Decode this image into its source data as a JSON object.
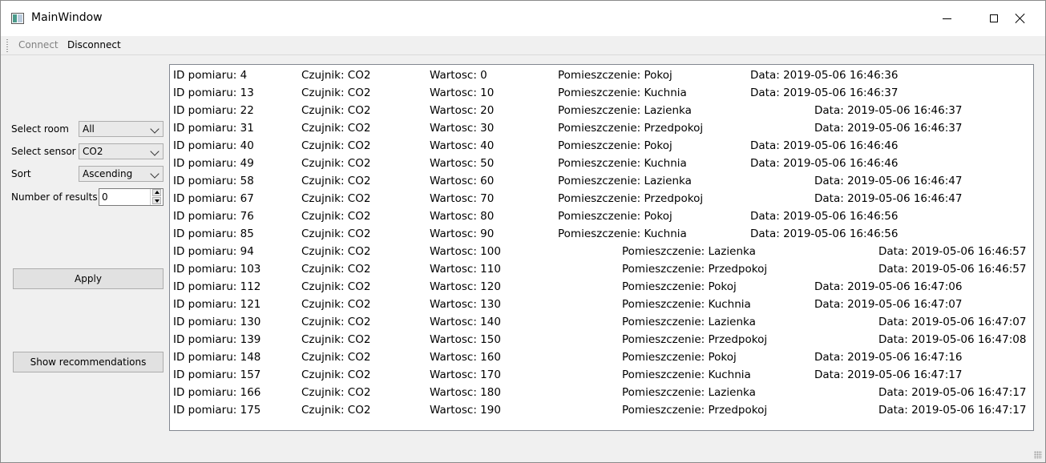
{
  "window": {
    "title": "MainWindow"
  },
  "toolbar": {
    "connect_label": "Connect",
    "disconnect_label": "Disconnect"
  },
  "controls": {
    "room_label": "Select room",
    "room_value": "All",
    "sensor_label": "Select sensor",
    "sensor_value": "CO2",
    "sort_label": "Sort",
    "sort_value": "Ascending",
    "results_label": "Number of results",
    "results_value": "0",
    "apply_label": "Apply",
    "recommend_label": "Show recommendations"
  },
  "results": [
    {
      "id": "ID pomiaru: 4",
      "sensor": "Czujnik: CO2",
      "value": "Wartosc: 0",
      "room": "Pomieszczenie: Pokoj",
      "date": "Data: 2019-05-06 16:46:36"
    },
    {
      "id": "ID pomiaru: 13",
      "sensor": "Czujnik: CO2",
      "value": "Wartosc: 10",
      "room": "Pomieszczenie: Kuchnia",
      "date": "Data: 2019-05-06 16:46:37"
    },
    {
      "id": "ID pomiaru: 22",
      "sensor": "Czujnik: CO2",
      "value": "Wartosc: 20",
      "room": "Pomieszczenie: Lazienka",
      "date": "Data: 2019-05-06 16:46:37"
    },
    {
      "id": "ID pomiaru: 31",
      "sensor": "Czujnik: CO2",
      "value": "Wartosc: 30",
      "room": "Pomieszczenie: Przedpokoj",
      "date": "Data: 2019-05-06 16:46:37"
    },
    {
      "id": "ID pomiaru: 40",
      "sensor": "Czujnik: CO2",
      "value": "Wartosc: 40",
      "room": "Pomieszczenie: Pokoj",
      "date": "Data: 2019-05-06 16:46:46"
    },
    {
      "id": "ID pomiaru: 49",
      "sensor": "Czujnik: CO2",
      "value": "Wartosc: 50",
      "room": "Pomieszczenie: Kuchnia",
      "date": "Data: 2019-05-06 16:46:46"
    },
    {
      "id": "ID pomiaru: 58",
      "sensor": "Czujnik: CO2",
      "value": "Wartosc: 60",
      "room": "Pomieszczenie: Lazienka",
      "date": "Data: 2019-05-06 16:46:47"
    },
    {
      "id": "ID pomiaru: 67",
      "sensor": "Czujnik: CO2",
      "value": "Wartosc: 70",
      "room": "Pomieszczenie: Przedpokoj",
      "date": "Data: 2019-05-06 16:46:47"
    },
    {
      "id": "ID pomiaru: 76",
      "sensor": "Czujnik: CO2",
      "value": "Wartosc: 80",
      "room": "Pomieszczenie: Pokoj",
      "date": "Data: 2019-05-06 16:46:56"
    },
    {
      "id": "ID pomiaru: 85",
      "sensor": "Czujnik: CO2",
      "value": "Wartosc: 90",
      "room": "Pomieszczenie: Kuchnia",
      "date": "Data: 2019-05-06 16:46:56"
    },
    {
      "id": "ID pomiaru: 94",
      "sensor": "Czujnik: CO2",
      "value": "Wartosc: 100",
      "room": "Pomieszczenie: Lazienka",
      "date": "Data: 2019-05-06 16:46:57"
    },
    {
      "id": "ID pomiaru: 103",
      "sensor": "Czujnik: CO2",
      "value": "Wartosc: 110",
      "room": "Pomieszczenie: Przedpokoj",
      "date": "Data: 2019-05-06 16:46:57"
    },
    {
      "id": "ID pomiaru: 112",
      "sensor": "Czujnik: CO2",
      "value": "Wartosc: 120",
      "room": "Pomieszczenie: Pokoj",
      "date": "Data: 2019-05-06 16:47:06"
    },
    {
      "id": "ID pomiaru: 121",
      "sensor": "Czujnik: CO2",
      "value": "Wartosc: 130",
      "room": "Pomieszczenie: Kuchnia",
      "date": "Data: 2019-05-06 16:47:07"
    },
    {
      "id": "ID pomiaru: 130",
      "sensor": "Czujnik: CO2",
      "value": "Wartosc: 140",
      "room": "Pomieszczenie: Lazienka",
      "date": "Data: 2019-05-06 16:47:07"
    },
    {
      "id": "ID pomiaru: 139",
      "sensor": "Czujnik: CO2",
      "value": "Wartosc: 150",
      "room": "Pomieszczenie: Przedpokoj",
      "date": "Data: 2019-05-06 16:47:08"
    },
    {
      "id": "ID pomiaru: 148",
      "sensor": "Czujnik: CO2",
      "value": "Wartosc: 160",
      "room": "Pomieszczenie: Pokoj",
      "date": "Data: 2019-05-06 16:47:16"
    },
    {
      "id": "ID pomiaru: 157",
      "sensor": "Czujnik: CO2",
      "value": "Wartosc: 170",
      "room": "Pomieszczenie: Kuchnia",
      "date": "Data: 2019-05-06 16:47:17"
    },
    {
      "id": "ID pomiaru: 166",
      "sensor": "Czujnik: CO2",
      "value": "Wartosc: 180",
      "room": "Pomieszczenie: Lazienka",
      "date": "Data: 2019-05-06 16:47:17"
    },
    {
      "id": "ID pomiaru: 175",
      "sensor": "Czujnik: CO2",
      "value": "Wartosc: 190",
      "room": "Pomieszczenie: Przedpokoj",
      "date": "Data: 2019-05-06 16:47:17"
    }
  ]
}
